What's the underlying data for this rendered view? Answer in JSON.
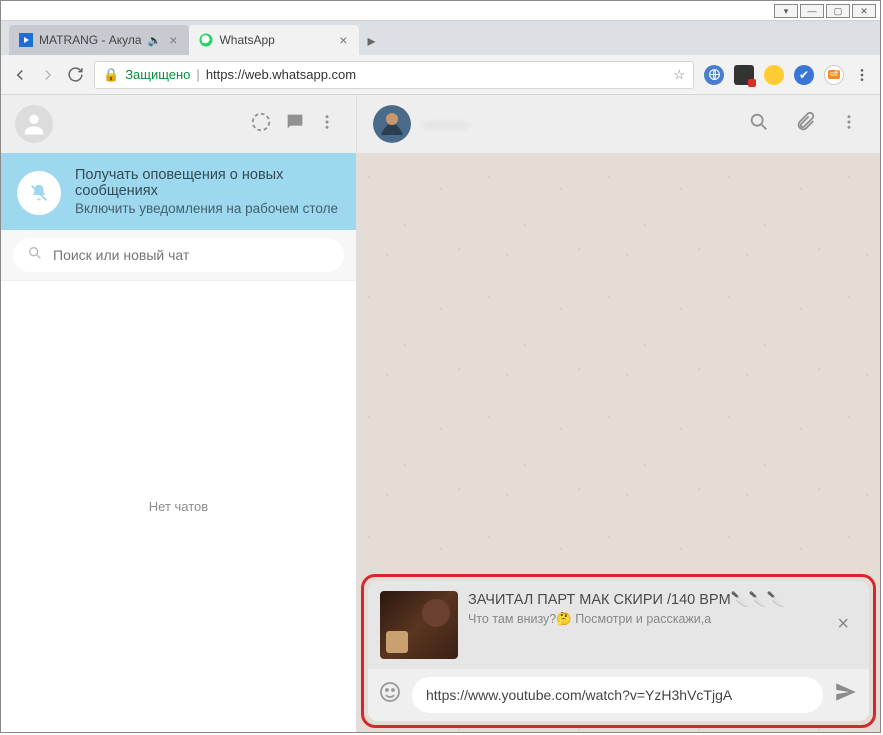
{
  "window_controls": {
    "min": "—",
    "max": "▢",
    "close": "✕",
    "extra": "▾"
  },
  "tabs": {
    "inactive": {
      "title": "MATRANG - Акула",
      "audio_glyph": "🔈",
      "close": "×"
    },
    "active": {
      "title": "WhatsApp",
      "close": "×"
    }
  },
  "addressbar": {
    "secure_label": "Защищено",
    "url_display": "https://web.whatsapp.com"
  },
  "left_pane": {
    "notification": {
      "line1": "Получать оповещения о новых сообщениях",
      "line2": "Включить уведомления на рабочем столе"
    },
    "search_placeholder": "Поиск или новый чат",
    "empty_label": "Нет чатов"
  },
  "chat": {
    "contact_name": "———",
    "preview_title": "ЗАЧИТАЛ ПАРТ МАК СКИРИ /140 BPM🔪🔪🔪",
    "preview_sub": "Что там внизу?🤔 Посмотри и расскажи,а",
    "input_text": "https://www.youtube.com/watch?v=YzH3hVcTjgA"
  }
}
